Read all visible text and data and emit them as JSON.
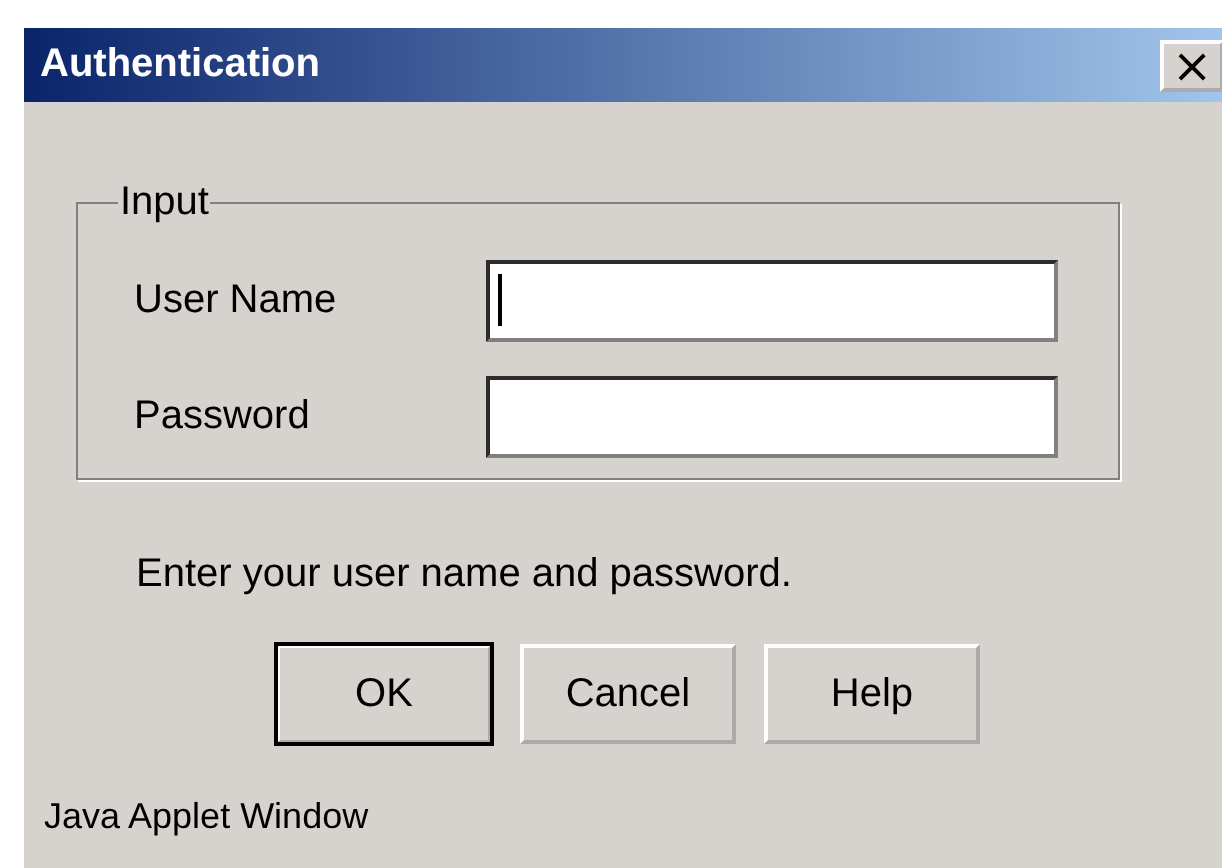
{
  "window": {
    "title": "Authentication",
    "close_glyph": "×"
  },
  "group": {
    "legend": "Input",
    "fields": [
      {
        "label": "User Name",
        "focused": true
      },
      {
        "label": "Password",
        "focused": false
      }
    ]
  },
  "message": "Enter your user name and password.",
  "buttons": [
    {
      "label": "OK",
      "default": true
    },
    {
      "label": "Cancel",
      "default": false
    },
    {
      "label": "Help",
      "default": false
    }
  ],
  "status_bar": "Java Applet Window"
}
